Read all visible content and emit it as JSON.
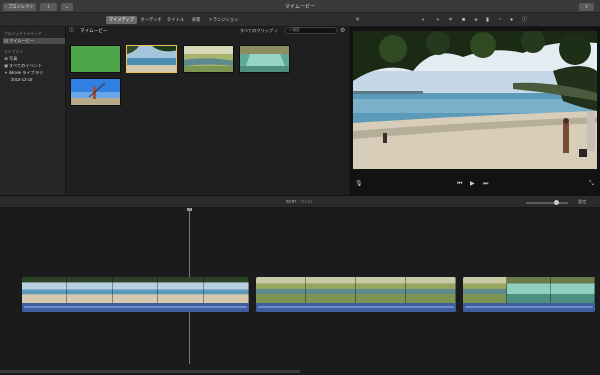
{
  "window": {
    "title": "マイムービー",
    "projects_button": "プロジェクト",
    "nav_icons": [
      "import-icon",
      "share-icon"
    ],
    "share_button_icon": "share-icon"
  },
  "toolbar": {
    "tabs": [
      {
        "label": "マイメディア",
        "active": true
      },
      {
        "label": "オーディオ",
        "active": false
      },
      {
        "label": "タイトル",
        "active": false
      },
      {
        "label": "背景",
        "active": false
      },
      {
        "label": "トランジション",
        "active": false
      }
    ],
    "viewer_tools": [
      "magic-wand-icon",
      "color-balance-icon",
      "color-correction-icon",
      "crop-icon",
      "stabilize-icon",
      "volume-icon",
      "eq-icon",
      "speed-icon",
      "filter-icon",
      "info-icon"
    ]
  },
  "sidebar": {
    "section_project": "プロジェクトメディア",
    "project_item": "マイムービー",
    "section_library": "ライブラリ",
    "items": [
      {
        "label": "写真",
        "icon": "photos-icon"
      },
      {
        "label": "すべてのイベント",
        "icon": "events-icon"
      },
      {
        "label": "iMovie ライブラリ",
        "icon": "disclosure-icon"
      },
      {
        "label": "2016-12-18",
        "icon": ""
      }
    ]
  },
  "browser": {
    "title": "マイムービー",
    "filter_label": "すべてのクリップ ◇",
    "search_placeholder": "検索",
    "clips": [
      {
        "kind": "green",
        "selected": false
      },
      {
        "kind": "beach",
        "selected": true
      },
      {
        "kind": "river",
        "selected": false
      },
      {
        "kind": "waterfall",
        "selected": false
      },
      {
        "kind": "person",
        "selected": false
      }
    ]
  },
  "viewer": {
    "controls": [
      "mic-icon",
      "skip-back-icon",
      "play-icon",
      "skip-forward-icon",
      "fullscreen-icon"
    ]
  },
  "timeline": {
    "timecode": "00:07",
    "duration": "/ 01:01",
    "settings_label": "設定",
    "zoom_level": 0.72,
    "clips": [
      {
        "frames": [
          "beach",
          "beach",
          "beach",
          "beach",
          "beach"
        ]
      },
      {
        "frames": [
          "river",
          "river",
          "river",
          "river"
        ]
      },
      {
        "frames": [
          "river",
          "waterfall",
          "waterfall"
        ]
      }
    ]
  }
}
